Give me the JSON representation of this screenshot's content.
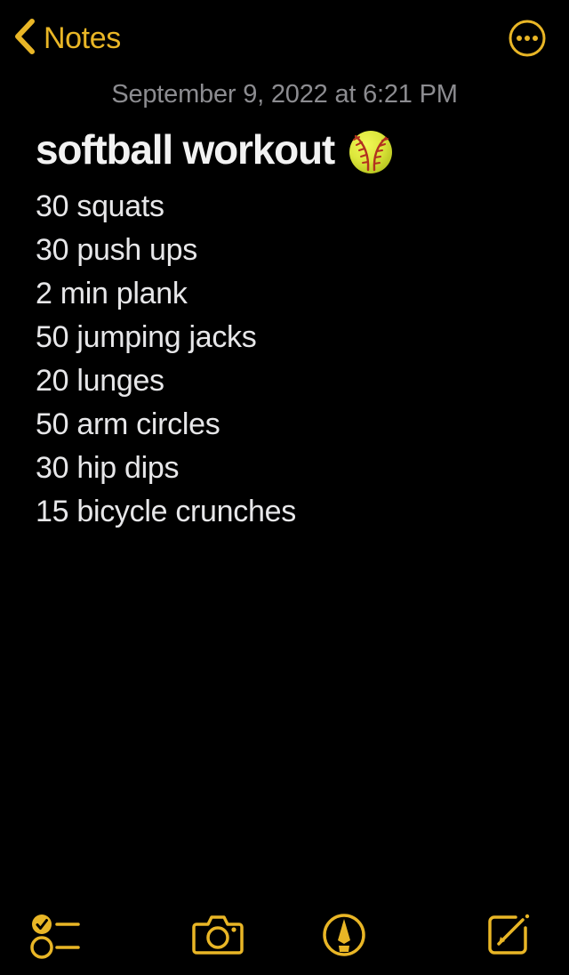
{
  "app": {
    "name": "Notes",
    "accent_color": "#E9B626",
    "background_color": "#000000",
    "body_text_color": "#E7E7E9",
    "date_text_color": "#8C8C90"
  },
  "navbar": {
    "back_label": "Notes",
    "back_icon": "chevron-left-icon",
    "more_icon": "ellipsis-circle-icon"
  },
  "note": {
    "date": "September 9, 2022 at 6:21 PM",
    "title": "softball workout",
    "title_emoji": "softball-emoji",
    "lines": [
      "30 squats",
      "30 push ups",
      "2 min plank",
      "50 jumping jacks",
      "20 lunges",
      "50 arm circles",
      "30 hip dips",
      "15 bicycle crunches"
    ]
  },
  "toolbar": {
    "items": [
      {
        "name": "checklist",
        "icon": "checklist-icon"
      },
      {
        "name": "camera",
        "icon": "camera-icon"
      },
      {
        "name": "markup",
        "icon": "markup-pen-icon"
      },
      {
        "name": "compose",
        "icon": "compose-icon"
      }
    ]
  }
}
